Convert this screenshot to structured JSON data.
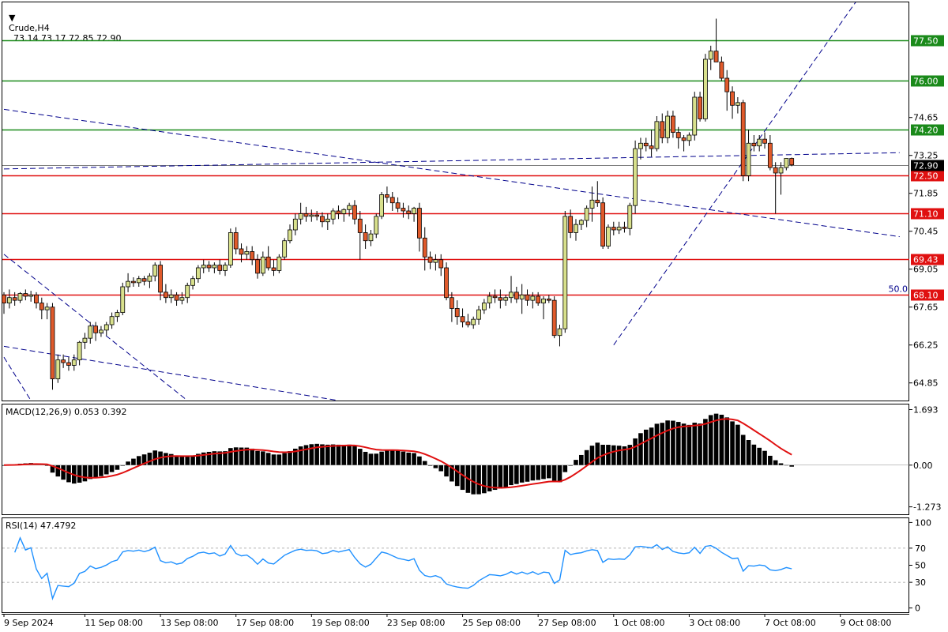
{
  "header": {
    "symbol": "Crude,H4",
    "ohlc": "73.14 73.17 72.85 72.90"
  },
  "colors": {
    "bull": "#d8e08c",
    "bear": "#e05a2b",
    "resistance": "#1a8a1a",
    "support": "#e01010",
    "trend": "#00008b",
    "signal": "#e01010",
    "rsi": "#1e90ff"
  },
  "chart_data": [
    {
      "type": "candlestick",
      "name": "price",
      "ylim": [
        64.2,
        78.9
      ],
      "y_ticks": [
        "77.50",
        "76.00",
        "74.65",
        "74.20",
        "73.25",
        "72.90",
        "72.50",
        "71.85",
        "71.10",
        "70.45",
        "69.43",
        "69.05",
        "68.10",
        "67.65",
        "66.25",
        "64.85"
      ],
      "x_labels": [
        "9 Sep 2024",
        "11 Sep 08:00",
        "13 Sep 08:00",
        "17 Sep 08:00",
        "19 Sep 08:00",
        "23 Sep 08:00",
        "25 Sep 08:00",
        "27 Sep 08:00",
        "1 Oct 08:00",
        "3 Oct 08:00",
        "7 Oct 08:00",
        "9 Oct 08:00"
      ],
      "x_label_index": [
        0,
        15,
        29,
        43,
        57,
        71,
        85,
        99,
        113,
        127,
        141,
        155
      ],
      "current_price": 72.9,
      "levels": [
        {
          "value": 77.5,
          "label": "77.50",
          "kind": "resistance"
        },
        {
          "value": 76.0,
          "label": "76.00",
          "kind": "resistance"
        },
        {
          "value": 74.2,
          "label": "74.20",
          "kind": "resistance"
        },
        {
          "value": 72.5,
          "label": "72.50",
          "kind": "support"
        },
        {
          "value": 71.1,
          "label": "71.10",
          "kind": "support"
        },
        {
          "value": 69.43,
          "label": "69.43",
          "kind": "support"
        },
        {
          "value": 68.1,
          "label": "68.10",
          "kind": "support"
        }
      ],
      "fib_label": "50.0",
      "trendlines": [
        {
          "from": [
            0,
            74.95
          ],
          "to": [
            166,
            70.25
          ]
        },
        {
          "from": [
            0,
            72.75
          ],
          "to": [
            166,
            73.35
          ]
        },
        {
          "from": [
            113,
            66.25
          ],
          "to": [
            158,
            78.95
          ]
        },
        {
          "from": [
            0,
            69.6
          ],
          "to": [
            34,
            64.2
          ]
        },
        {
          "from": [
            0,
            66.2
          ],
          "to": [
            62,
            64.2
          ]
        },
        {
          "from": [
            0,
            65.8
          ],
          "to": [
            5,
            64.2
          ]
        }
      ],
      "ohlc": [
        [
          68.1,
          68.2,
          67.4,
          67.8
        ],
        [
          67.8,
          68.3,
          67.6,
          68.0
        ],
        [
          68.0,
          68.2,
          67.7,
          67.9
        ],
        [
          67.9,
          68.2,
          67.8,
          68.15
        ],
        [
          68.15,
          68.3,
          67.9,
          68.05
        ],
        [
          68.05,
          68.25,
          67.85,
          68.1
        ],
        [
          68.1,
          68.2,
          67.6,
          67.8
        ],
        [
          67.8,
          68.0,
          67.2,
          67.55
        ],
        [
          67.55,
          67.8,
          67.2,
          67.65
        ],
        [
          67.65,
          67.8,
          64.6,
          65.0
        ],
        [
          65.0,
          65.9,
          64.85,
          65.7
        ],
        [
          65.7,
          65.9,
          65.4,
          65.6
        ],
        [
          65.6,
          65.8,
          65.3,
          65.5
        ],
        [
          65.5,
          65.9,
          65.3,
          65.7
        ],
        [
          65.7,
          66.4,
          65.5,
          66.35
        ],
        [
          66.35,
          66.7,
          66.1,
          66.5
        ],
        [
          66.5,
          67.1,
          66.3,
          66.95
        ],
        [
          66.95,
          67.1,
          66.4,
          66.7
        ],
        [
          66.7,
          66.95,
          66.55,
          66.8
        ],
        [
          66.8,
          67.1,
          66.6,
          67.0
        ],
        [
          67.0,
          67.45,
          66.85,
          67.3
        ],
        [
          67.3,
          67.55,
          67.1,
          67.45
        ],
        [
          67.45,
          68.55,
          67.35,
          68.4
        ],
        [
          68.4,
          68.9,
          68.2,
          68.6
        ],
        [
          68.6,
          68.75,
          68.4,
          68.55
        ],
        [
          68.55,
          68.8,
          68.4,
          68.7
        ],
        [
          68.7,
          68.8,
          68.45,
          68.6
        ],
        [
          68.6,
          68.9,
          68.35,
          68.8
        ],
        [
          68.8,
          69.3,
          68.6,
          69.2
        ],
        [
          69.2,
          69.35,
          67.9,
          68.2
        ],
        [
          68.2,
          68.5,
          67.8,
          68.0
        ],
        [
          68.0,
          68.3,
          67.8,
          68.1
        ],
        [
          68.1,
          68.2,
          67.7,
          67.9
        ],
        [
          67.9,
          68.2,
          67.75,
          68.0
        ],
        [
          68.0,
          68.55,
          67.8,
          68.45
        ],
        [
          68.45,
          68.8,
          68.3,
          68.7
        ],
        [
          68.7,
          69.2,
          68.55,
          69.1
        ],
        [
          69.1,
          69.4,
          68.9,
          69.2
        ],
        [
          69.2,
          69.35,
          68.95,
          69.1
        ],
        [
          69.1,
          69.3,
          68.9,
          69.2
        ],
        [
          69.2,
          69.4,
          68.85,
          69.0
        ],
        [
          69.0,
          69.3,
          68.8,
          69.2
        ],
        [
          69.2,
          70.55,
          69.1,
          70.4
        ],
        [
          70.4,
          70.6,
          69.6,
          69.8
        ],
        [
          69.8,
          70.0,
          69.3,
          69.6
        ],
        [
          69.6,
          69.9,
          69.4,
          69.7
        ],
        [
          69.7,
          69.9,
          69.2,
          69.4
        ],
        [
          69.4,
          69.6,
          68.7,
          68.9
        ],
        [
          68.9,
          69.7,
          68.8,
          69.5
        ],
        [
          69.5,
          69.9,
          69.0,
          69.1
        ],
        [
          69.1,
          69.4,
          68.8,
          69.0
        ],
        [
          69.0,
          69.6,
          68.9,
          69.5
        ],
        [
          69.5,
          70.2,
          69.4,
          70.1
        ],
        [
          70.1,
          70.7,
          70.0,
          70.5
        ],
        [
          70.5,
          71.1,
          70.3,
          70.9
        ],
        [
          70.9,
          71.5,
          70.7,
          71.1
        ],
        [
          71.1,
          71.35,
          70.8,
          71.0
        ],
        [
          71.0,
          71.25,
          70.8,
          71.05
        ],
        [
          71.05,
          71.2,
          70.85,
          71.0
        ],
        [
          71.0,
          71.15,
          70.6,
          70.8
        ],
        [
          70.8,
          71.1,
          70.5,
          70.9
        ],
        [
          70.9,
          71.3,
          70.7,
          71.2
        ],
        [
          71.2,
          71.4,
          70.9,
          71.1
        ],
        [
          71.1,
          71.3,
          70.8,
          71.25
        ],
        [
          71.25,
          71.5,
          71.0,
          71.4
        ],
        [
          71.4,
          71.6,
          70.7,
          70.9
        ],
        [
          70.9,
          71.2,
          69.4,
          70.4
        ],
        [
          70.4,
          70.7,
          69.8,
          70.1
        ],
        [
          70.1,
          70.5,
          69.9,
          70.35
        ],
        [
          70.35,
          71.1,
          70.2,
          71.0
        ],
        [
          71.0,
          71.9,
          70.9,
          71.8
        ],
        [
          71.8,
          72.1,
          71.5,
          71.7
        ],
        [
          71.7,
          71.9,
          71.2,
          71.5
        ],
        [
          71.5,
          71.7,
          71.15,
          71.3
        ],
        [
          71.3,
          71.5,
          70.95,
          71.2
        ],
        [
          71.2,
          71.4,
          70.9,
          71.1
        ],
        [
          71.1,
          71.35,
          70.8,
          71.3
        ],
        [
          71.3,
          71.5,
          69.7,
          70.2
        ],
        [
          70.2,
          70.6,
          69.0,
          69.5
        ],
        [
          69.5,
          69.7,
          69.05,
          69.3
        ],
        [
          69.3,
          69.6,
          69.0,
          69.4
        ],
        [
          69.4,
          69.6,
          68.8,
          69.1
        ],
        [
          69.1,
          69.3,
          67.9,
          68.0
        ],
        [
          68.0,
          68.2,
          67.1,
          67.6
        ],
        [
          67.6,
          67.9,
          67.0,
          67.3
        ],
        [
          67.3,
          67.6,
          66.9,
          67.1
        ],
        [
          67.1,
          67.4,
          66.9,
          67.0
        ],
        [
          67.0,
          67.3,
          66.85,
          67.2
        ],
        [
          67.2,
          67.7,
          67.0,
          67.55
        ],
        [
          67.55,
          67.95,
          67.4,
          67.8
        ],
        [
          67.8,
          68.2,
          67.6,
          68.05
        ],
        [
          68.05,
          68.3,
          67.8,
          68.0
        ],
        [
          68.0,
          68.3,
          67.6,
          67.9
        ],
        [
          67.9,
          68.1,
          67.7,
          68.0
        ],
        [
          68.0,
          68.8,
          67.8,
          68.2
        ],
        [
          68.2,
          68.4,
          67.8,
          67.95
        ],
        [
          67.95,
          68.5,
          67.4,
          68.1
        ],
        [
          68.1,
          68.3,
          67.7,
          67.9
        ],
        [
          67.9,
          68.2,
          67.6,
          68.05
        ],
        [
          68.05,
          68.2,
          67.7,
          67.8
        ],
        [
          67.8,
          68.05,
          67.2,
          67.95
        ],
        [
          67.95,
          68.1,
          67.8,
          67.9
        ],
        [
          67.9,
          68.05,
          66.5,
          66.6
        ],
        [
          66.6,
          67.0,
          66.2,
          66.85
        ],
        [
          66.85,
          71.2,
          66.7,
          71.0
        ],
        [
          71.0,
          71.25,
          70.2,
          70.4
        ],
        [
          70.4,
          70.9,
          70.1,
          70.7
        ],
        [
          70.7,
          70.9,
          70.5,
          70.85
        ],
        [
          70.85,
          71.4,
          70.6,
          71.3
        ],
        [
          71.3,
          72.1,
          70.8,
          71.6
        ],
        [
          71.6,
          72.3,
          71.35,
          71.5
        ],
        [
          71.5,
          71.7,
          69.8,
          69.9
        ],
        [
          69.9,
          70.7,
          69.8,
          70.6
        ],
        [
          70.6,
          70.8,
          70.3,
          70.5
        ],
        [
          70.5,
          70.8,
          70.35,
          70.6
        ],
        [
          70.6,
          70.8,
          70.4,
          70.55
        ],
        [
          70.55,
          71.5,
          70.3,
          71.4
        ],
        [
          71.4,
          73.8,
          71.1,
          73.5
        ],
        [
          73.5,
          73.9,
          73.1,
          73.7
        ],
        [
          73.7,
          73.9,
          73.4,
          73.6
        ],
        [
          73.6,
          74.2,
          73.2,
          73.5
        ],
        [
          73.5,
          74.7,
          73.4,
          74.5
        ],
        [
          74.5,
          74.8,
          73.7,
          73.9
        ],
        [
          73.9,
          74.9,
          73.7,
          74.7
        ],
        [
          74.7,
          74.9,
          73.9,
          74.1
        ],
        [
          74.1,
          74.3,
          73.5,
          73.9
        ],
        [
          73.9,
          74.0,
          73.4,
          73.8
        ],
        [
          73.8,
          74.1,
          73.6,
          74.0
        ],
        [
          74.0,
          75.6,
          73.8,
          75.4
        ],
        [
          75.4,
          75.6,
          74.5,
          74.6
        ],
        [
          74.6,
          77.0,
          74.5,
          76.8
        ],
        [
          76.8,
          77.3,
          76.4,
          77.1
        ],
        [
          77.1,
          78.3,
          76.9,
          76.7
        ],
        [
          76.7,
          76.9,
          76.0,
          76.1
        ],
        [
          76.1,
          76.4,
          74.9,
          75.6
        ],
        [
          75.6,
          75.8,
          74.6,
          75.1
        ],
        [
          75.1,
          75.4,
          74.8,
          75.2
        ],
        [
          75.2,
          75.3,
          72.3,
          72.5
        ],
        [
          72.5,
          74.2,
          72.3,
          73.7
        ],
        [
          73.7,
          74.0,
          73.4,
          73.6
        ],
        [
          73.6,
          74.0,
          73.4,
          73.85
        ],
        [
          73.85,
          74.1,
          73.5,
          73.7
        ],
        [
          73.7,
          74.0,
          72.7,
          72.8
        ],
        [
          72.8,
          73.0,
          71.1,
          72.6
        ],
        [
          72.6,
          73.0,
          71.8,
          72.8
        ],
        [
          72.8,
          73.15,
          72.7,
          73.14
        ],
        [
          73.14,
          73.17,
          72.85,
          72.9
        ]
      ]
    },
    {
      "type": "bar",
      "name": "macd",
      "title": "MACD(12,26,9) 0.053 0.392",
      "ylim": [
        -1.5,
        1.85
      ],
      "y_ticks": [
        "1.693",
        "0.00",
        "-1.273"
      ],
      "signal_line": true
    },
    {
      "type": "line",
      "name": "rsi",
      "title": "RSI(14) 47.4792",
      "ylim": [
        -5,
        105
      ],
      "y_ticks": [
        "100",
        "70",
        "50",
        "30",
        "0"
      ],
      "levels": [
        70,
        30
      ]
    }
  ]
}
